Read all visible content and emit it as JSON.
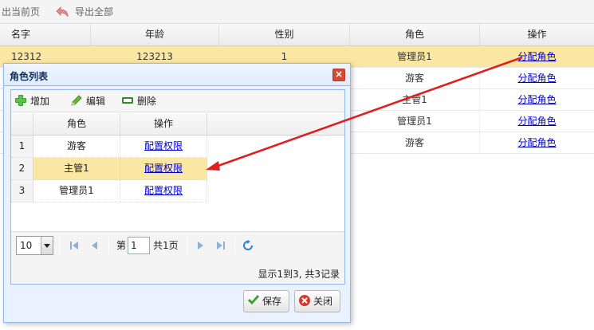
{
  "top_toolbar": {
    "export_page_label": "出当前页",
    "export_all_label": "导出全部"
  },
  "grid": {
    "columns": [
      "名字",
      "年龄",
      "性别",
      "角色",
      "操作"
    ],
    "rows": [
      {
        "name": "12312",
        "age": "123213",
        "sex": "1",
        "role": "管理员1",
        "action": "分配角色"
      },
      {
        "name": "",
        "age": "",
        "sex": "",
        "role": "游客",
        "action": "分配角色"
      },
      {
        "name": "",
        "age": "",
        "sex": "",
        "role": "主管1",
        "action": "分配角色"
      },
      {
        "name": "",
        "age": "",
        "sex": "",
        "role": "管理员1",
        "action": "分配角色"
      },
      {
        "name": "",
        "age": "",
        "sex": "",
        "role": "游客",
        "action": "分配角色"
      }
    ],
    "selected_row": 0
  },
  "dialog": {
    "title": "角色列表",
    "close_glyph": "×",
    "toolbar": {
      "add_label": "增加",
      "edit_label": "编辑",
      "delete_label": "删除"
    },
    "table": {
      "columns": [
        "角色",
        "操作"
      ],
      "rows": [
        {
          "num": "1",
          "role": "游客",
          "action": "配置权限"
        },
        {
          "num": "2",
          "role": "主管1",
          "action": "配置权限"
        },
        {
          "num": "3",
          "role": "管理员1",
          "action": "配置权限"
        }
      ],
      "selected_row": 1
    },
    "pager": {
      "page_size": "10",
      "page_prefix": "第",
      "current_page": "1",
      "total_pages": "共1页",
      "info": "显示1到3, 共3记录"
    },
    "buttons": {
      "save_label": "保存",
      "close_label": "关闭"
    }
  },
  "colors": {
    "selected_row": "#fbe7a4",
    "link": "#0000cc",
    "annotation_arrow": "#e02020",
    "dialog_border": "#95b8e7"
  }
}
